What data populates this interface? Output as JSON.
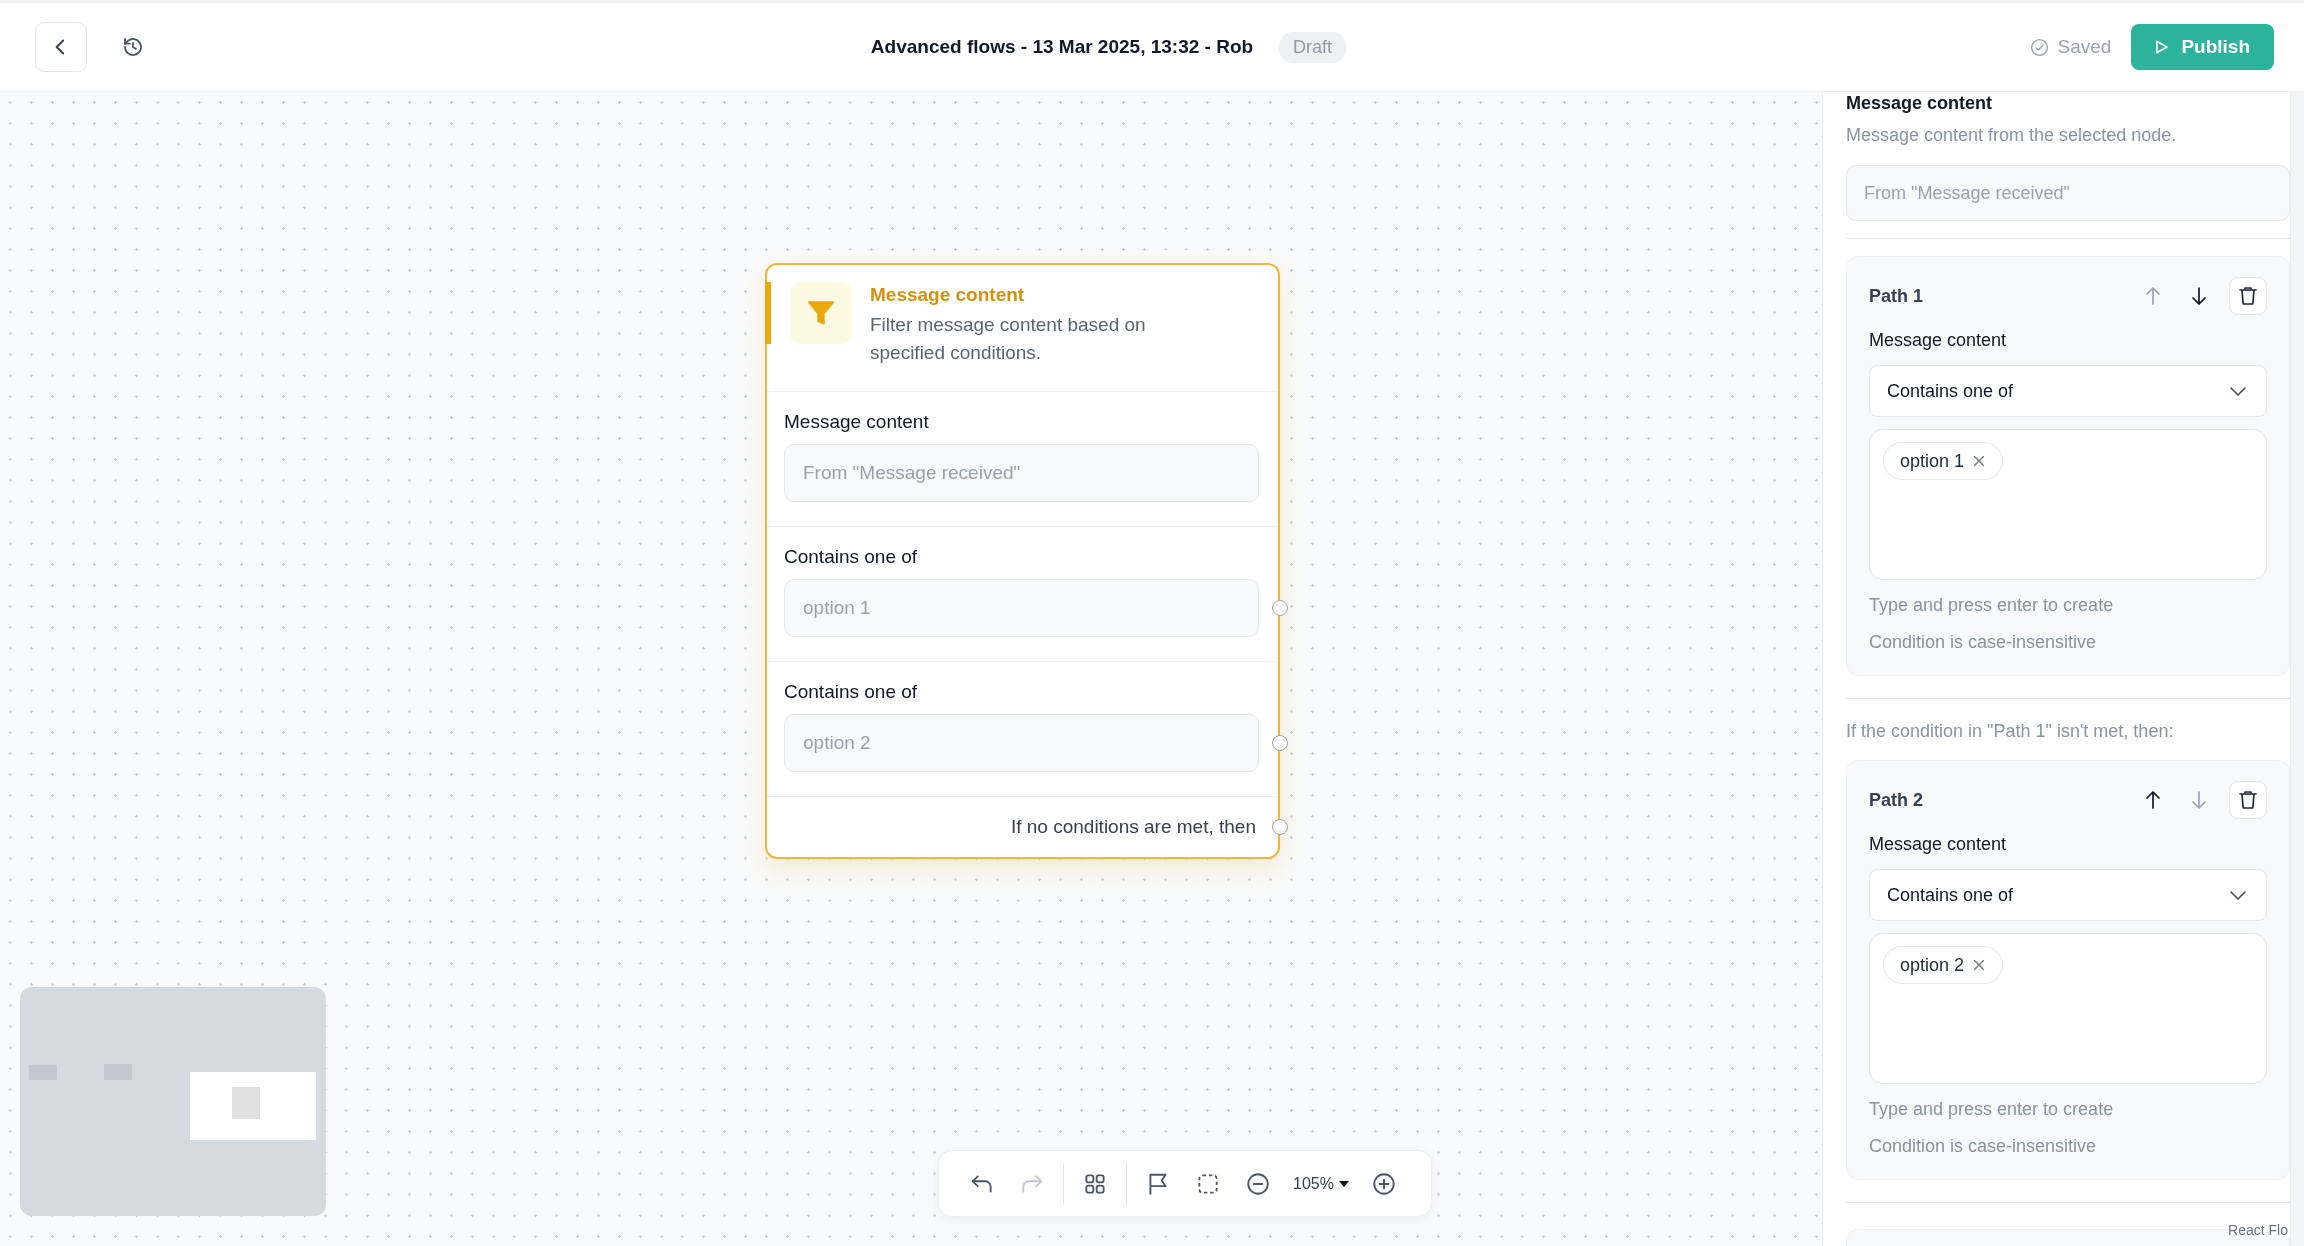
{
  "header": {
    "title": "Advanced flows - 13 Mar 2025, 13:32 - Rob",
    "status_badge": "Draft",
    "save_status": "Saved",
    "publish_button": "Publish"
  },
  "node": {
    "title": "Message content",
    "description": "Filter message content based on specified conditions.",
    "selected": true,
    "fields": [
      {
        "kind": "source",
        "label": "Message content",
        "placeholder": "From \"Message received\""
      },
      {
        "kind": "condition",
        "label": "Contains one of",
        "placeholder": "option 1"
      },
      {
        "kind": "condition",
        "label": "Contains one of",
        "placeholder": "option 2"
      }
    ],
    "fallback": "If no conditions are met, then"
  },
  "toolbar": {
    "tools": [
      {
        "kind": "undo",
        "disabled": false
      },
      {
        "kind": "redo",
        "disabled": true
      },
      {
        "kind": "divider"
      },
      {
        "kind": "layout",
        "disabled": false
      },
      {
        "kind": "divider"
      },
      {
        "kind": "flag",
        "disabled": false
      },
      {
        "kind": "select",
        "disabled": false
      },
      {
        "kind": "zoom_out",
        "disabled": false
      },
      {
        "kind": "zoom_level",
        "label": "105%"
      },
      {
        "kind": "zoom_in",
        "disabled": false
      }
    ]
  },
  "panel": {
    "title": "Message content",
    "description": "Message content from the selected node.",
    "source_placeholder": "From \"Message received\"",
    "paths": [
      {
        "title": "Path 1",
        "up_disabled": true,
        "down_disabled": false,
        "field_label": "Message content",
        "operator": "Contains one of",
        "tags": [
          "option 1"
        ],
        "hint": "Type and press enter to create",
        "note": "Condition is case-insensitive"
      },
      {
        "preface": "If the condition in \"Path 1\" isn't met, then:",
        "title": "Path 2",
        "up_disabled": false,
        "down_disabled": true,
        "field_label": "Message content",
        "operator": "Contains one of",
        "tags": [
          "option 2"
        ],
        "hint": "Type and press enter to create",
        "note": "Condition is case-insensitive"
      }
    ],
    "attribution": "React Flo"
  }
}
